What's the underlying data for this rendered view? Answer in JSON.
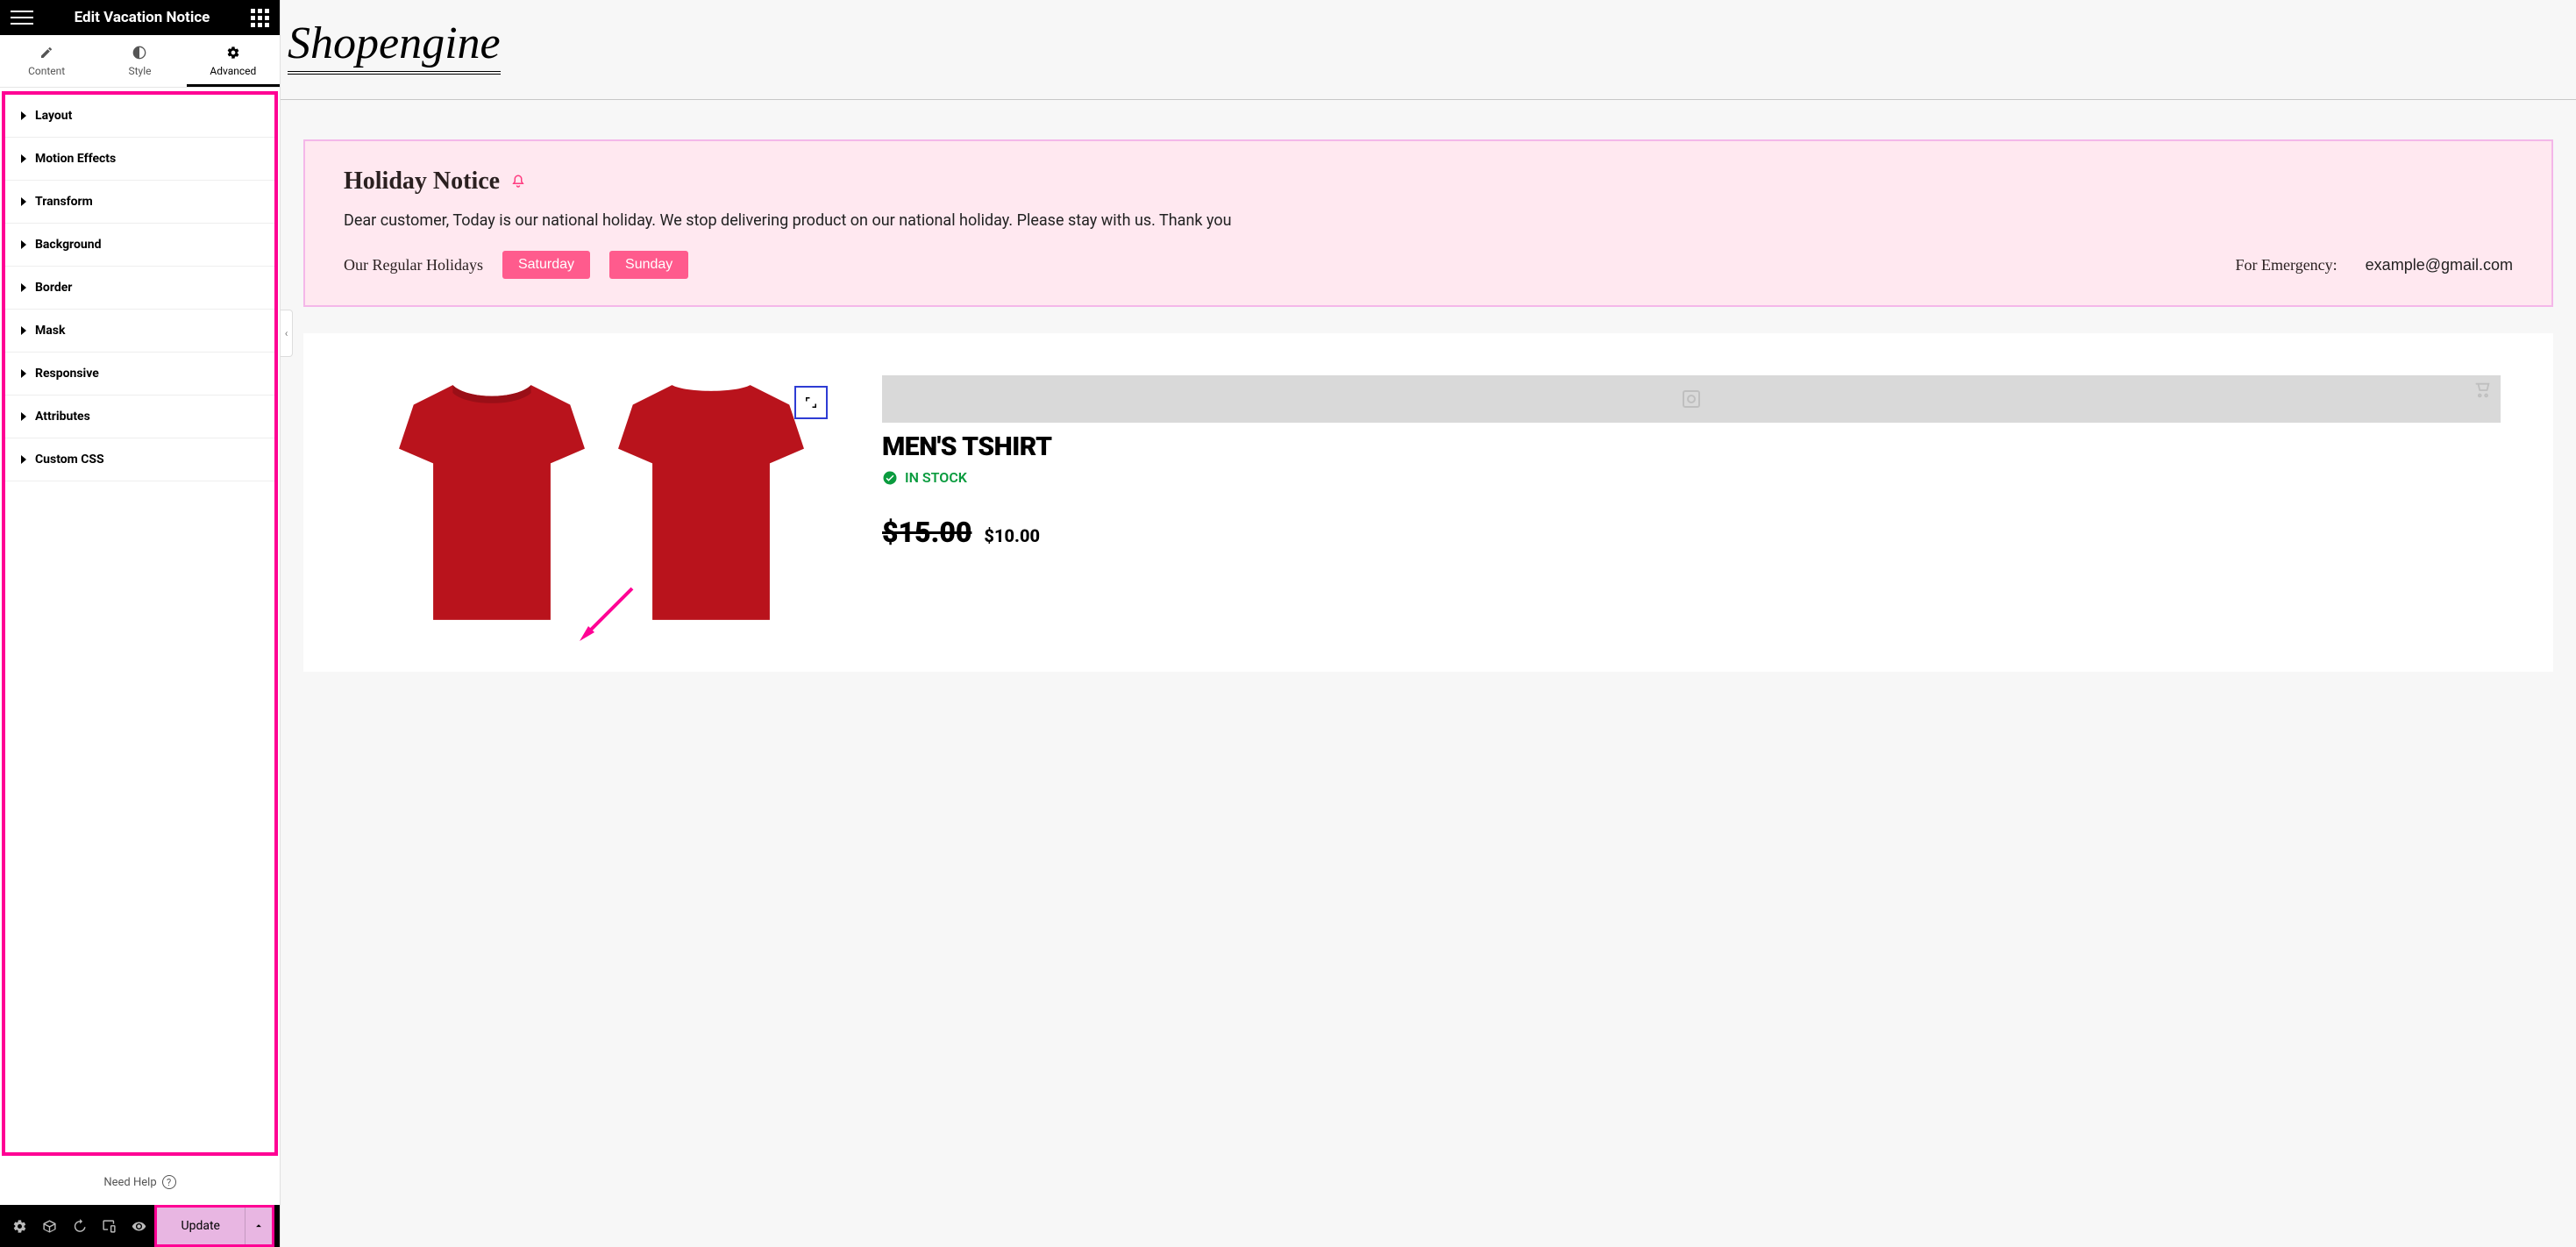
{
  "sidebar": {
    "title": "Edit Vacation Notice",
    "tabs": [
      {
        "label": "Content"
      },
      {
        "label": "Style"
      },
      {
        "label": "Advanced"
      }
    ],
    "sections": [
      {
        "label": "Layout"
      },
      {
        "label": "Motion Effects"
      },
      {
        "label": "Transform"
      },
      {
        "label": "Background"
      },
      {
        "label": "Border"
      },
      {
        "label": "Mask"
      },
      {
        "label": "Responsive"
      },
      {
        "label": "Attributes"
      },
      {
        "label": "Custom CSS"
      }
    ],
    "help_label": "Need Help",
    "update_label": "Update"
  },
  "brand": "Shopengine",
  "notice": {
    "title": "Holiday Notice",
    "message": "Dear customer, Today is our national holiday. We stop delivering product on our national holiday. Please stay with us. Thank you",
    "regular_label": "Our Regular Holidays",
    "days": [
      "Saturday",
      "Sunday"
    ],
    "emergency_label": "For Emergency:",
    "emergency_value": "example@gmail.com"
  },
  "product": {
    "title": "MEN'S TSHIRT",
    "stock": "IN STOCK",
    "old_price": "$15.00",
    "new_price": "$10.00"
  }
}
